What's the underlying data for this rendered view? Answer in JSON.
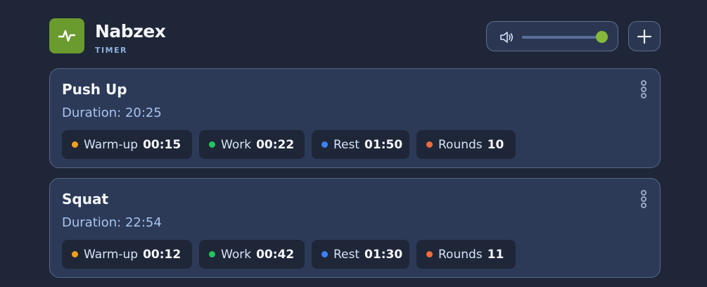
{
  "app": {
    "name": "Nabzex",
    "subtitle": "TIMER",
    "logo_icon": "pulse-icon",
    "accent": "#6b9a2e"
  },
  "volume": {
    "icon": "speaker-icon",
    "level": 1.0
  },
  "toolbar": {
    "add_icon": "plus-icon"
  },
  "workouts": [
    {
      "title": "Push Up",
      "duration": "Duration: 20:25",
      "chips": [
        {
          "label": "Warm-up",
          "value": "00:15",
          "color": "#f0a020"
        },
        {
          "label": "Work",
          "value": "00:22",
          "color": "#22c55e"
        },
        {
          "label": "Rest",
          "value": "01:50",
          "color": "#3b82f6"
        },
        {
          "label": "Rounds",
          "value": "10",
          "color": "#f06a3a"
        }
      ]
    },
    {
      "title": "Squat",
      "duration": "Duration: 22:54",
      "chips": [
        {
          "label": "Warm-up",
          "value": "00:12",
          "color": "#f0a020"
        },
        {
          "label": "Work",
          "value": "00:42",
          "color": "#22c55e"
        },
        {
          "label": "Rest",
          "value": "01:30",
          "color": "#3b82f6"
        },
        {
          "label": "Rounds",
          "value": "11",
          "color": "#f06a3a"
        }
      ]
    }
  ]
}
